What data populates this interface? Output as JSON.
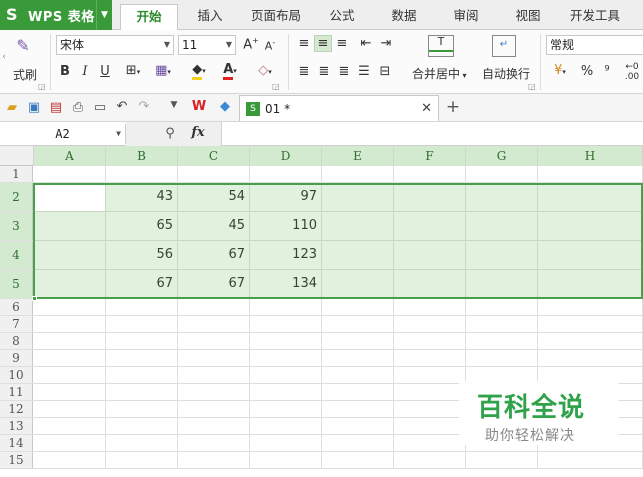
{
  "app": {
    "logo": "S",
    "name": "WPS 表格"
  },
  "ribbon_tabs": [
    "开始",
    "插入",
    "页面布局",
    "公式",
    "数据",
    "审阅",
    "视图",
    "开发工具"
  ],
  "ribbon": {
    "format_painter_label": "式刷",
    "font_name": "宋体",
    "font_size": "11",
    "merge_center_label": "合并居中",
    "wrap_text_label": "自动换行",
    "number_format": "常规",
    "percent_symbol": "%"
  },
  "quickbar": {
    "doc_tab_name": "01 *",
    "new_tab_label": "+"
  },
  "formula_bar": {
    "name_box": "A2",
    "fx_label": "fx"
  },
  "grid": {
    "columns": [
      "A",
      "B",
      "C",
      "D",
      "E",
      "F",
      "G",
      "H"
    ],
    "selected_columns": [
      "A",
      "B",
      "C",
      "D",
      "E",
      "F",
      "G",
      "H"
    ],
    "row_numbers": [
      "1",
      "2",
      "3",
      "4",
      "5",
      "6",
      "7",
      "8",
      "9",
      "10",
      "11",
      "12",
      "13",
      "14",
      "15"
    ],
    "selected_rows": [
      "2",
      "3",
      "4",
      "5"
    ],
    "data": {
      "2": {
        "B": "43",
        "C": "54",
        "D": "97"
      },
      "3": {
        "B": "65",
        "C": "45",
        "D": "110"
      },
      "4": {
        "B": "56",
        "C": "67",
        "D": "123"
      },
      "5": {
        "B": "67",
        "C": "67",
        "D": "134"
      }
    },
    "selection_color": "#4aa04a"
  },
  "watermark": {
    "title": "百科全说",
    "subtitle": "助你轻松解决"
  },
  "colors": {
    "accent": "#3a9a3a",
    "active_tab_text": "#2b8a2b",
    "watermark_green": "#2fa24a"
  }
}
